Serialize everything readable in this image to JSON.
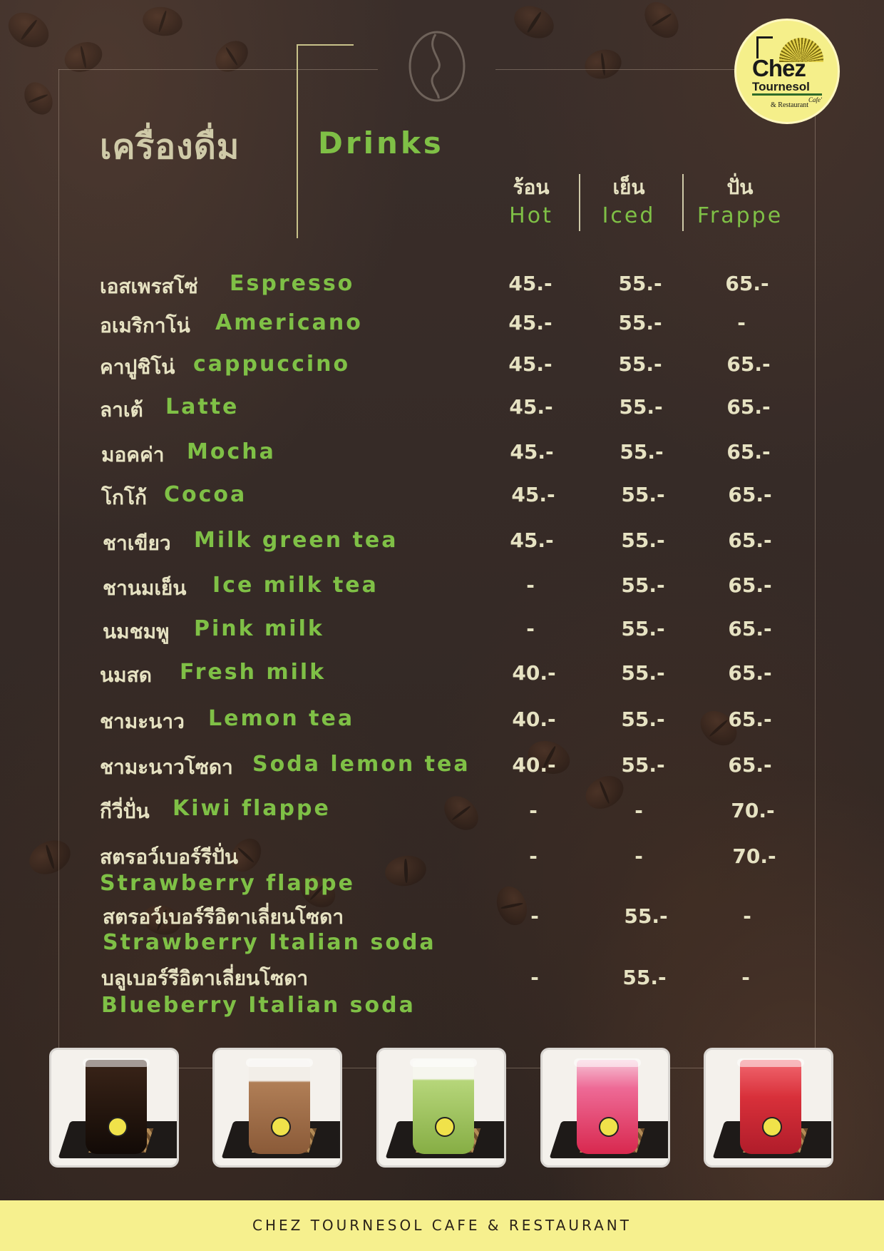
{
  "logo": {
    "line1": "Chez",
    "line2": "Tournesol",
    "cafe": "Cafe'",
    "restaurant": "& Restaurant"
  },
  "title": {
    "th": "เครื่องดื่ม",
    "en": "Drinks"
  },
  "columns": [
    {
      "th": "ร้อน",
      "en": "Hot"
    },
    {
      "th": "เย็น",
      "en": "Iced"
    },
    {
      "th": "ปั่น",
      "en": "Frappe"
    }
  ],
  "items": [
    {
      "th": "เอสเพรสโซ่",
      "en": "Espresso",
      "hot": "45.-",
      "iced": "55.-",
      "frappe": "65.-"
    },
    {
      "th": "อเมริกาโน่",
      "en": "Americano",
      "hot": "45.-",
      "iced": "55.-",
      "frappe": "-"
    },
    {
      "th": "คาปูชิโน่",
      "en": "cappuccino",
      "hot": "45.-",
      "iced": "55.-",
      "frappe": "65.-"
    },
    {
      "th": "ลาเต้",
      "en": "Latte",
      "hot": "45.-",
      "iced": "55.-",
      "frappe": "65.-"
    },
    {
      "th": "มอคค่า",
      "en": "Mocha",
      "hot": "45.-",
      "iced": "55.-",
      "frappe": "65.-"
    },
    {
      "th": "โกโก้",
      "en": "Cocoa",
      "hot": "45.-",
      "iced": "55.-",
      "frappe": "65.-"
    },
    {
      "th": "ชาเขียว",
      "en": "Milk green tea",
      "hot": "45.-",
      "iced": "55.-",
      "frappe": "65.-"
    },
    {
      "th": "ชานมเย็น",
      "en": "Ice milk tea",
      "hot": "-",
      "iced": "55.-",
      "frappe": "65.-"
    },
    {
      "th": "นมชมพู",
      "en": "Pink milk",
      "hot": "-",
      "iced": "55.-",
      "frappe": "65.-"
    },
    {
      "th": "นมสด",
      "en": "Fresh milk",
      "hot": "40.-",
      "iced": "55.-",
      "frappe": "65.-"
    },
    {
      "th": "ชามะนาว",
      "en": "Lemon tea",
      "hot": "40.-",
      "iced": "55.-",
      "frappe": "65.-"
    },
    {
      "th": "ชามะนาวโซดา",
      "en": "Soda lemon tea",
      "hot": "40.-",
      "iced": "55.-",
      "frappe": "65.-"
    },
    {
      "th": "กีวี่ปั่น",
      "en": "Kiwi flappe",
      "hot": "-",
      "iced": "-",
      "frappe": "70.-"
    },
    {
      "th": "สตรอว์เบอร์รีปั่น",
      "en": "Strawberry flappe",
      "hot": "-",
      "iced": "-",
      "frappe": "70.-"
    },
    {
      "th": "สตรอว์เบอร์รีอิตาเลี่ยนโซดา",
      "en": "Strawberry Italian soda",
      "hot": "-",
      "iced": "55.-",
      "frappe": "-"
    },
    {
      "th": "บลูเบอร์รีอิตาเลี่ยนโซดา",
      "en": "Blueberry Italian soda",
      "hot": "-",
      "iced": "55.-",
      "frappe": "-"
    }
  ],
  "photos": [
    {
      "name": "iced-americano-photo",
      "color": "#1b120d"
    },
    {
      "name": "iced-mocha-photo",
      "color": "#a8764e"
    },
    {
      "name": "green-tea-frappe-photo",
      "color": "#9cc25a"
    },
    {
      "name": "pink-soda-photo",
      "color": "#e84a78"
    },
    {
      "name": "strawberry-frappe-photo",
      "color": "#d8303a"
    }
  ],
  "footer": "CHEZ TOURNESOL CAFE & RESTAURANT",
  "colors": {
    "accent": "#7fc046",
    "text": "#e6e2c2",
    "footer_bg": "#f6f08e",
    "logo_bg": "#f5ef8a"
  }
}
